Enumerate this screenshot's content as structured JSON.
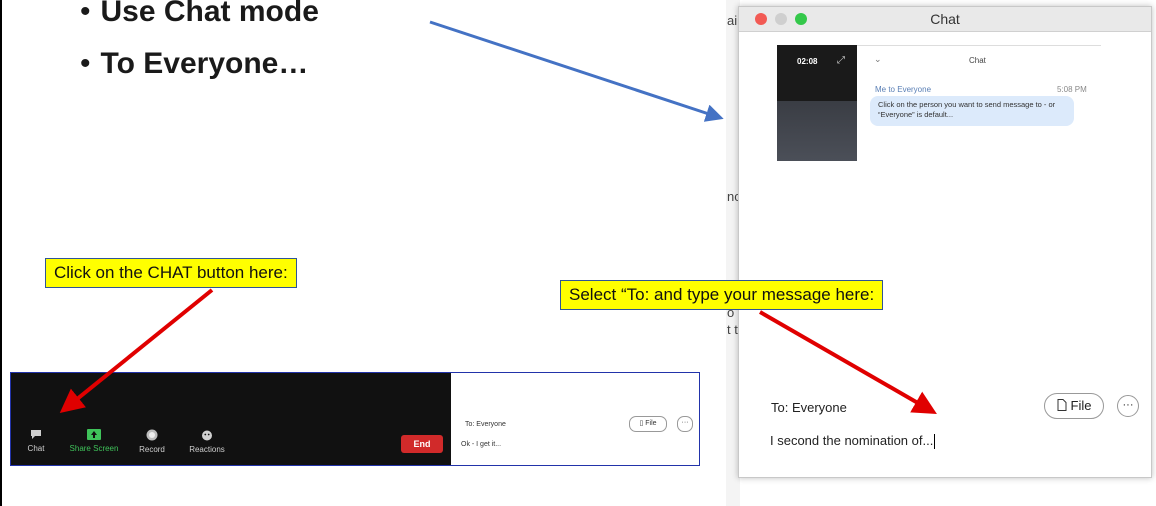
{
  "slide": {
    "bullets": [
      "Use Chat mode",
      "To Everyone…"
    ],
    "callouts": {
      "chat_button": "Click on the CHAT button here:",
      "select_to": "Select “To: and type your message here:"
    },
    "background_fragments": [
      "ai",
      "nc",
      "o y",
      "t th"
    ]
  },
  "meeting_bar": {
    "buttons": [
      {
        "label": "Chat",
        "icon": "chat-bubble-icon"
      },
      {
        "label": "Share Screen",
        "icon": "share-screen-icon"
      },
      {
        "label": "Record",
        "icon": "record-icon"
      },
      {
        "label": "Reactions",
        "icon": "reactions-icon"
      }
    ],
    "end_label": "End",
    "chat_panel": {
      "to_label": "To: Everyone",
      "message": "Ok - I get it...",
      "file_label": "File",
      "more_label": "···"
    }
  },
  "chat_window": {
    "title": "Chat",
    "video_timer": "02:08",
    "inner_title": "Chat",
    "message": {
      "from": "Me to Everyone",
      "time": "5:08 PM",
      "text": "Click on the person you want to send message to - or “Everyone” is default..."
    },
    "to_label": "To: Everyone",
    "file_label": "File",
    "more_label": "···",
    "input_value": "I second the nomination of..."
  },
  "colors": {
    "callout_bg": "#ffff00",
    "red_arrow": "#e00000",
    "blue_arrow": "#4472c4",
    "share_green": "#3fc35a",
    "end_red": "#d12a2a"
  }
}
